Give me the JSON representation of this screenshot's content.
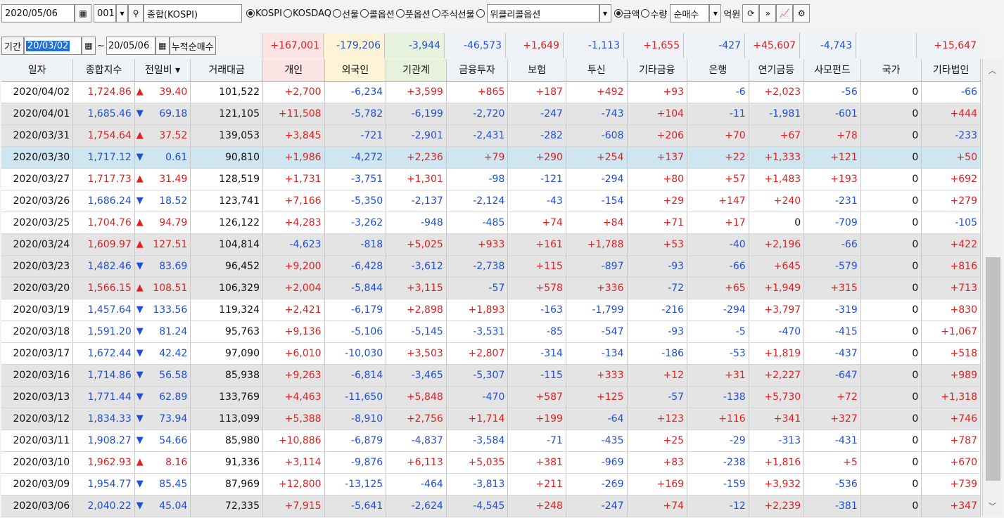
{
  "toolbar": {
    "date": "2020/05/06",
    "code": "001",
    "market_name": "종합(KOSPI)",
    "radios": [
      "KOSPI",
      "KOSDAQ",
      "선물",
      "콜옵션",
      "풋옵션",
      "주식선물"
    ],
    "weekly_option": "위클리콜옵션",
    "amount": "금액",
    "quantity": "수량",
    "mode": "순매수",
    "unit": "억원"
  },
  "period": {
    "label": "기간",
    "from": "20/03/02",
    "tilde": "~",
    "to": "20/05/06",
    "cum_label": "누적순매수"
  },
  "cumulative": [
    "+167,001",
    "-179,206",
    "-3,944",
    "-46,573",
    "+1,649",
    "-1,113",
    "+1,655",
    "-427",
    "+45,607",
    "-4,743",
    "",
    "+15,647"
  ],
  "columns": [
    "일자",
    "종합지수",
    "전일비",
    "거래대금",
    "개인",
    "외국인",
    "기관계",
    "금융투자",
    "보험",
    "투신",
    "기타금융",
    "은행",
    "연기금등",
    "사모펀드",
    "국가",
    "기타법인"
  ],
  "rows": [
    [
      "2020/04/02",
      "1,724.86",
      "up",
      "39.40",
      "101,522",
      "+2,700",
      "-6,234",
      "+3,599",
      "+865",
      "+187",
      "+492",
      "+93",
      "-6",
      "+2,023",
      "-56",
      "0",
      "-66"
    ],
    [
      "2020/04/01",
      "1,685.46",
      "dn",
      "69.18",
      "121,105",
      "+11,508",
      "-5,782",
      "-6,199",
      "-2,720",
      "-247",
      "-743",
      "+104",
      "-11",
      "-1,981",
      "-601",
      "0",
      "+444"
    ],
    [
      "2020/03/31",
      "1,754.64",
      "up",
      "37.52",
      "139,053",
      "+3,845",
      "-721",
      "-2,901",
      "-2,431",
      "-282",
      "-608",
      "+206",
      "+70",
      "+67",
      "+78",
      "0",
      "-233"
    ],
    [
      "2020/03/30",
      "1,717.12",
      "dn",
      "0.61",
      "90,810",
      "+1,986",
      "-4,272",
      "+2,236",
      "+79",
      "+290",
      "+254",
      "+137",
      "+22",
      "+1,333",
      "+121",
      "0",
      "+50"
    ],
    [
      "2020/03/27",
      "1,717.73",
      "up",
      "31.49",
      "128,519",
      "+1,731",
      "-3,751",
      "+1,301",
      "-98",
      "-121",
      "-294",
      "+80",
      "+57",
      "+1,483",
      "+193",
      "0",
      "+692"
    ],
    [
      "2020/03/26",
      "1,686.24",
      "dn",
      "18.52",
      "123,741",
      "+7,166",
      "-5,350",
      "-2,137",
      "-2,124",
      "-43",
      "-154",
      "+29",
      "+147",
      "+240",
      "-231",
      "0",
      "+279"
    ],
    [
      "2020/03/25",
      "1,704.76",
      "up",
      "94.79",
      "126,122",
      "+4,283",
      "-3,262",
      "-948",
      "-485",
      "+74",
      "+84",
      "+71",
      "+17",
      "0",
      "-709",
      "0",
      "-105"
    ],
    [
      "2020/03/24",
      "1,609.97",
      "up",
      "127.51",
      "104,814",
      "-4,623",
      "-818",
      "+5,025",
      "+933",
      "+161",
      "+1,788",
      "+53",
      "-40",
      "+2,196",
      "-66",
      "0",
      "+422"
    ],
    [
      "2020/03/23",
      "1,482.46",
      "dn",
      "83.69",
      "96,452",
      "+9,200",
      "-6,428",
      "-3,612",
      "-2,738",
      "+115",
      "-897",
      "-93",
      "-66",
      "+645",
      "-579",
      "0",
      "+816"
    ],
    [
      "2020/03/20",
      "1,566.15",
      "up",
      "108.51",
      "106,329",
      "+2,004",
      "-5,844",
      "+3,115",
      "-57",
      "+578",
      "+336",
      "-72",
      "+65",
      "+1,949",
      "+315",
      "0",
      "+713"
    ],
    [
      "2020/03/19",
      "1,457.64",
      "dn",
      "133.56",
      "119,324",
      "+2,421",
      "-6,179",
      "+2,898",
      "+1,893",
      "-163",
      "-1,799",
      "-216",
      "-294",
      "+3,797",
      "-319",
      "0",
      "+830"
    ],
    [
      "2020/03/18",
      "1,591.20",
      "dn",
      "81.24",
      "95,763",
      "+9,136",
      "-5,106",
      "-5,145",
      "-3,531",
      "-85",
      "-547",
      "-93",
      "-5",
      "-470",
      "-415",
      "0",
      "+1,067"
    ],
    [
      "2020/03/17",
      "1,672.44",
      "dn",
      "42.42",
      "97,090",
      "+6,010",
      "-10,030",
      "+3,503",
      "+2,807",
      "-314",
      "-134",
      "-186",
      "-53",
      "+1,819",
      "-437",
      "0",
      "+518"
    ],
    [
      "2020/03/16",
      "1,714.86",
      "dn",
      "56.58",
      "85,938",
      "+9,263",
      "-6,814",
      "-3,465",
      "-5,307",
      "-115",
      "+333",
      "+12",
      "+31",
      "+2,227",
      "-647",
      "0",
      "+989"
    ],
    [
      "2020/03/13",
      "1,771.44",
      "dn",
      "62.89",
      "133,769",
      "+4,463",
      "-11,650",
      "+5,848",
      "-470",
      "+587",
      "+125",
      "-57",
      "-138",
      "+5,730",
      "+72",
      "0",
      "+1,318"
    ],
    [
      "2020/03/12",
      "1,834.33",
      "dn",
      "73.94",
      "113,099",
      "+5,388",
      "-8,910",
      "+2,756",
      "+1,714",
      "+199",
      "-64",
      "+123",
      "+116",
      "+341",
      "+327",
      "0",
      "+746"
    ],
    [
      "2020/03/11",
      "1,908.27",
      "dn",
      "54.66",
      "85,980",
      "+10,886",
      "-6,879",
      "-4,837",
      "-3,584",
      "-71",
      "-435",
      "+25",
      "-29",
      "-313",
      "-431",
      "0",
      "+787"
    ],
    [
      "2020/03/10",
      "1,962.93",
      "up",
      "8.16",
      "91,336",
      "+3,114",
      "-9,876",
      "+6,113",
      "+5,035",
      "+381",
      "-969",
      "+83",
      "-238",
      "+1,816",
      "+5",
      "0",
      "+670"
    ],
    [
      "2020/03/09",
      "1,954.77",
      "dn",
      "85.45",
      "87,969",
      "+12,800",
      "-13,125",
      "-464",
      "-3,813",
      "+211",
      "-269",
      "+169",
      "-159",
      "+3,932",
      "-536",
      "0",
      "+739"
    ],
    [
      "2020/03/06",
      "2,040.22",
      "dn",
      "45.04",
      "72,335",
      "+7,915",
      "-5,641",
      "-2,624",
      "-4,545",
      "+248",
      "-247",
      "+74",
      "-12",
      "+2,239",
      "-381",
      "0",
      "+347"
    ]
  ],
  "row_styles": [
    "white",
    "shade",
    "shade",
    "sel",
    "white",
    "white",
    "white",
    "shade",
    "shade",
    "shade",
    "white",
    "white",
    "white",
    "shade",
    "shade",
    "shade",
    "white",
    "white",
    "white",
    "shade"
  ],
  "colors": {
    "up": "#e02020",
    "down": "#1f4fd6",
    "selected_row": "#cfe6f1"
  }
}
